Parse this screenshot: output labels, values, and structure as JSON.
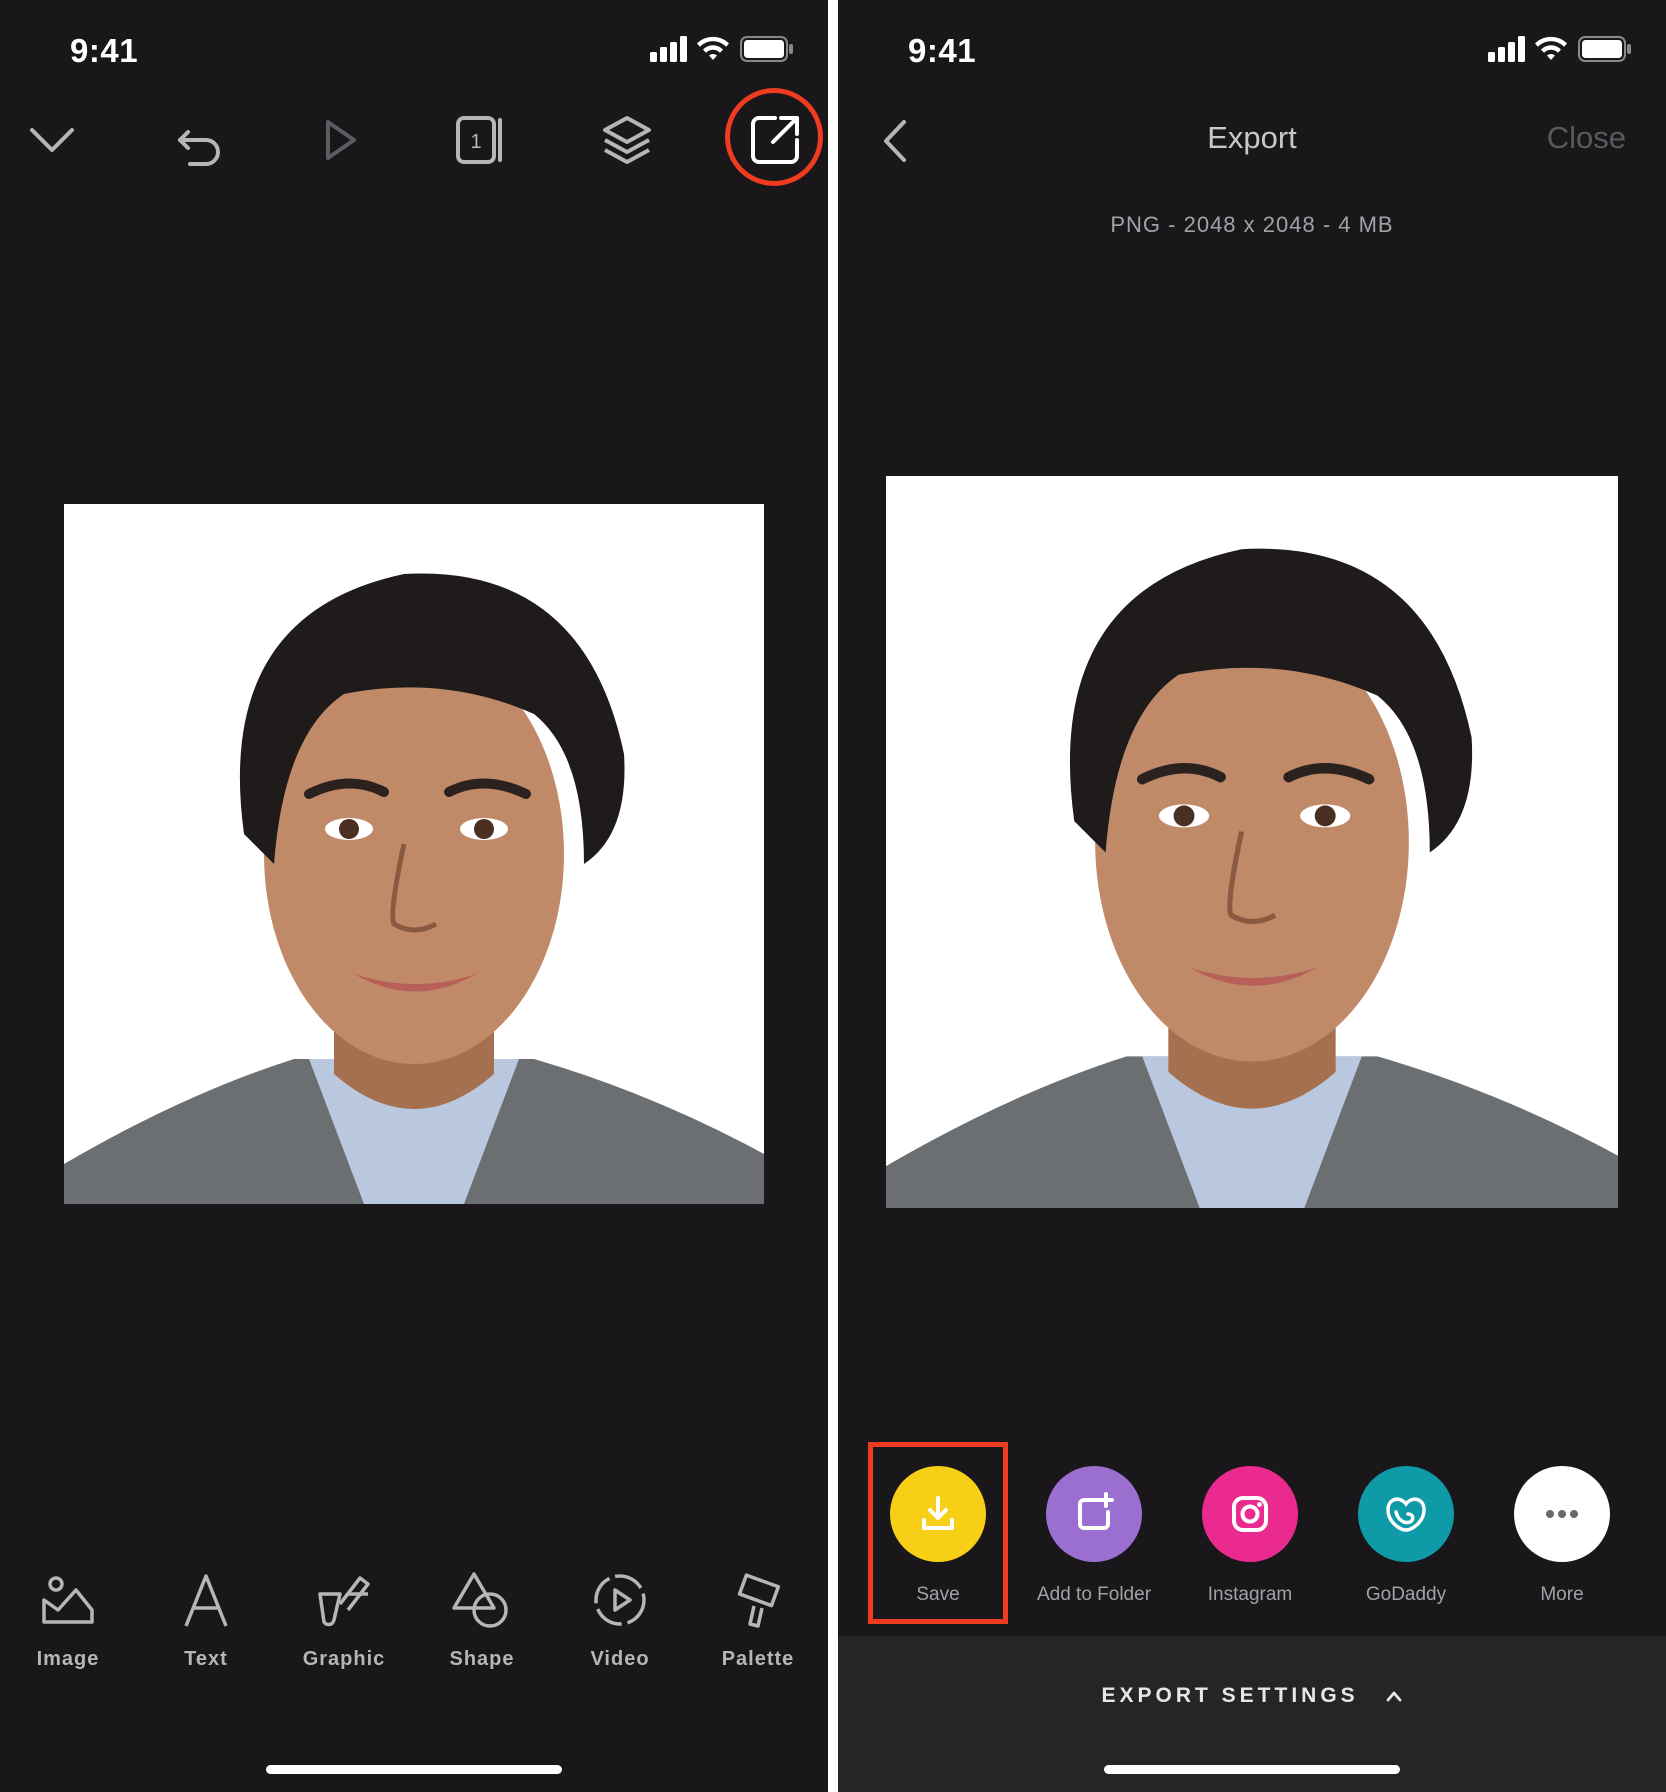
{
  "left": {
    "status": {
      "time": "9:41"
    },
    "toolbar": {
      "icons": [
        "chevron-down-icon",
        "undo-icon",
        "play-icon",
        "pages-icon",
        "layers-icon",
        "export-icon"
      ],
      "pages_count": "1"
    },
    "tools": [
      {
        "label": "Image",
        "icon": "image-icon"
      },
      {
        "label": "Text",
        "icon": "text-icon"
      },
      {
        "label": "Graphic",
        "icon": "graphic-icon"
      },
      {
        "label": "Shape",
        "icon": "shape-icon"
      },
      {
        "label": "Video",
        "icon": "video-icon"
      },
      {
        "label": "Palette",
        "icon": "palette-icon"
      }
    ]
  },
  "right": {
    "status": {
      "time": "9:41"
    },
    "nav": {
      "title": "Export",
      "close": "Close"
    },
    "info": "PNG - 2048 x 2048 - 4 MB",
    "share": [
      {
        "label": "Save",
        "icon": "download-icon",
        "color": "#f6cf16"
      },
      {
        "label": "Add to Folder",
        "icon": "add-folder-icon",
        "color": "#9b6fd0"
      },
      {
        "label": "Instagram",
        "icon": "instagram-icon",
        "color": "#ea2a8e"
      },
      {
        "label": "GoDaddy",
        "icon": "godaddy-icon",
        "color": "#0e9aa7"
      },
      {
        "label": "More",
        "icon": "more-icon",
        "color": "#ffffff"
      }
    ],
    "settings": {
      "label": "EXPORT SETTINGS"
    }
  },
  "colors": {
    "background": "#19171a",
    "highlight": "#ef3b1f",
    "settings_bar": "#262427"
  }
}
